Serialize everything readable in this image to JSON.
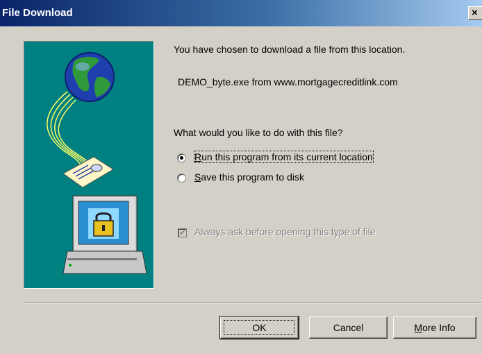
{
  "dialog": {
    "title": "File Download",
    "close_glyph": "×"
  },
  "icons": {
    "illustration": "download-illustration-icon",
    "close": "close-icon"
  },
  "content": {
    "intro": "You have chosen to download a file from this location.",
    "file_source": "DEMO_byte.exe from www.mortgagecreditlink.com",
    "question": "What would you like to do with this file?",
    "options": [
      {
        "label": "Run this program from its current location",
        "selected": true
      },
      {
        "label": "Save this program to disk",
        "selected": false
      }
    ],
    "always_ask": {
      "label": "Always ask before opening this type of file",
      "checked": true,
      "enabled": false
    }
  },
  "buttons": {
    "ok": "OK",
    "cancel": "Cancel",
    "more_info": "More Info"
  },
  "colors": {
    "titlebar_start": "#0a246a",
    "titlebar_end": "#a6caf0",
    "panel_bg": "#008080",
    "dialog_bg": "#d4d0c8"
  }
}
